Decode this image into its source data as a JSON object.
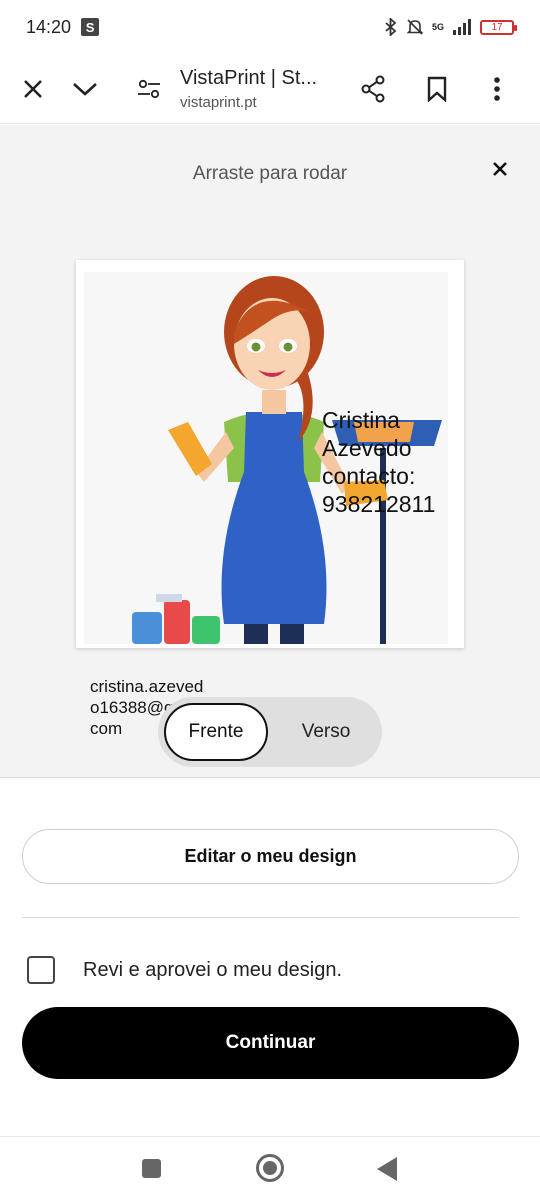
{
  "status_bar": {
    "time": "14:20",
    "badge": "S",
    "network": "5G",
    "battery": "17"
  },
  "browser": {
    "page_title": "VistaPrint | St...",
    "domain": "vistaprint.pt",
    "icons": [
      "close-icon",
      "chevron-down-icon",
      "tune-icon",
      "share-icon",
      "bookmark-icon",
      "more-vert-icon"
    ]
  },
  "preview": {
    "hint": "Arraste para rodar",
    "card": {
      "name_lines": [
        "Cristina",
        "Azevedo",
        "contacto:",
        "938212811"
      ],
      "email_lines": [
        "cristina.azeved",
        "o16388@gmail.",
        "com"
      ]
    },
    "toggle": {
      "front": "Frente",
      "back": "Verso",
      "selected": "Frente"
    }
  },
  "actions": {
    "edit_label": "Editar o meu design",
    "approve_label": "Revi e aprovei o meu design.",
    "approve_checked": false,
    "continue_label": "Continuar"
  },
  "colors": {
    "accent_black": "#000000",
    "battery_low": "#d32f2f"
  }
}
